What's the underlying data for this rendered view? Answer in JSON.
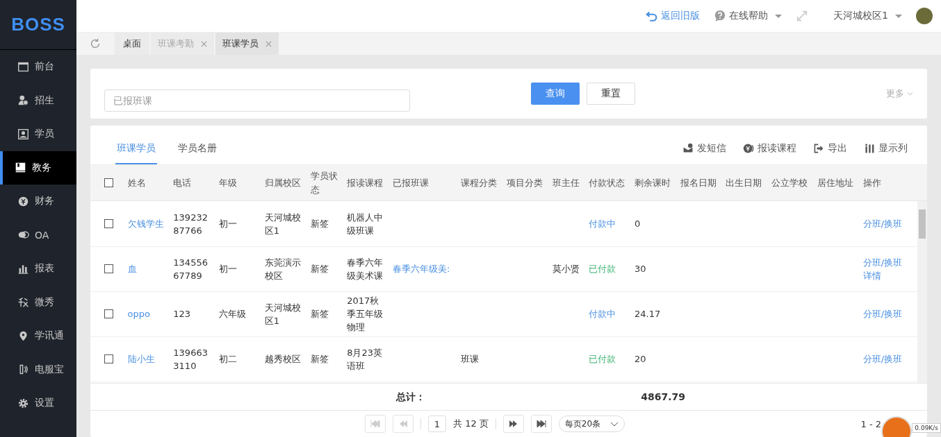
{
  "logo": "BOSS",
  "sidebar": {
    "items": [
      {
        "label": "前台",
        "selected": false
      },
      {
        "label": "招生",
        "selected": false
      },
      {
        "label": "学员",
        "selected": false
      },
      {
        "label": "教务",
        "selected": true
      },
      {
        "label": "财务",
        "selected": false
      },
      {
        "label": "OA",
        "selected": false
      },
      {
        "label": "报表",
        "selected": false
      },
      {
        "label": "微秀",
        "selected": false
      },
      {
        "label": "学讯通",
        "selected": false
      },
      {
        "label": "电服宝",
        "selected": false
      },
      {
        "label": "设置",
        "selected": false
      }
    ]
  },
  "header": {
    "back_link": "返回旧版",
    "help": "在线帮助",
    "campus": "天河城校区1"
  },
  "page_tabs": [
    {
      "label": "桌面",
      "closable": false,
      "selected": false
    },
    {
      "label": "班课考勤",
      "closable": true,
      "selected": false
    },
    {
      "label": "班课学员",
      "closable": true,
      "selected": true
    }
  ],
  "search": {
    "placeholder": "已报班课",
    "query_button": "查询",
    "reset_button": "重置",
    "more": "更多"
  },
  "view_tabs": [
    {
      "label": "班课学员",
      "selected": true
    },
    {
      "label": "学员名册",
      "selected": false
    }
  ],
  "toolbar": [
    {
      "label": "发短信"
    },
    {
      "label": "报读课程"
    },
    {
      "label": "导出"
    },
    {
      "label": "显示列"
    }
  ],
  "table": {
    "select_all_checked": false,
    "columns": [
      "姓名",
      "电话",
      "年级",
      "归属校区",
      "学员状态",
      "报读课程",
      "已报班课",
      "课程分类",
      "项目分类",
      "班主任",
      "付款状态",
      "剩余课时",
      "报名日期",
      "出生日期",
      "公立学校",
      "居住地址",
      "操作"
    ],
    "rows": [
      {
        "checked": false,
        "name": "欠钱学生",
        "phone": "13923287766",
        "grade": "初一",
        "campus": "天河城校区1",
        "student_status": "新签",
        "course": "机器人中级班课",
        "payment_status": {
          "text": "付款中",
          "kind": "paying"
        },
        "remaining_hours": "0",
        "actions": [
          "分班/换班"
        ]
      },
      {
        "checked": false,
        "name": "血",
        "phone": "13455667789",
        "grade": "初一",
        "campus": "东莞演示校区",
        "student_status": "新签",
        "course": "春季六年级美术课",
        "class": "春季六年级美:",
        "head_teacher": "莫小贤",
        "payment_status": {
          "text": "已付款",
          "kind": "paid"
        },
        "remaining_hours": "30",
        "actions": [
          "分班/换班",
          "详情"
        ]
      },
      {
        "checked": false,
        "name": "oppo",
        "phone": "123",
        "grade": "六年级",
        "campus": "天河城校区1",
        "student_status": "新签",
        "course": "2017秋季五年级物理",
        "payment_status": {
          "text": "付款中",
          "kind": "paying"
        },
        "remaining_hours": "24.17",
        "actions": [
          "分班/换班"
        ]
      },
      {
        "checked": false,
        "name": "陆小生",
        "phone": "1396633110",
        "grade": "初二",
        "campus": "越秀校区",
        "student_status": "新签",
        "course": "8月23英语班",
        "course_category": "班课",
        "payment_status": {
          "text": "已付款",
          "kind": "paid"
        },
        "remaining_hours": "20",
        "actions": [
          "分班/换班"
        ]
      }
    ],
    "total_label": "总计：",
    "total_hours": "4867.79"
  },
  "pager": {
    "page": "1",
    "pages_text": "共 12 页",
    "page_size": "每页20条",
    "summary": "1 - 2"
  },
  "speed_widget": {
    "text": "0.09K/s"
  }
}
